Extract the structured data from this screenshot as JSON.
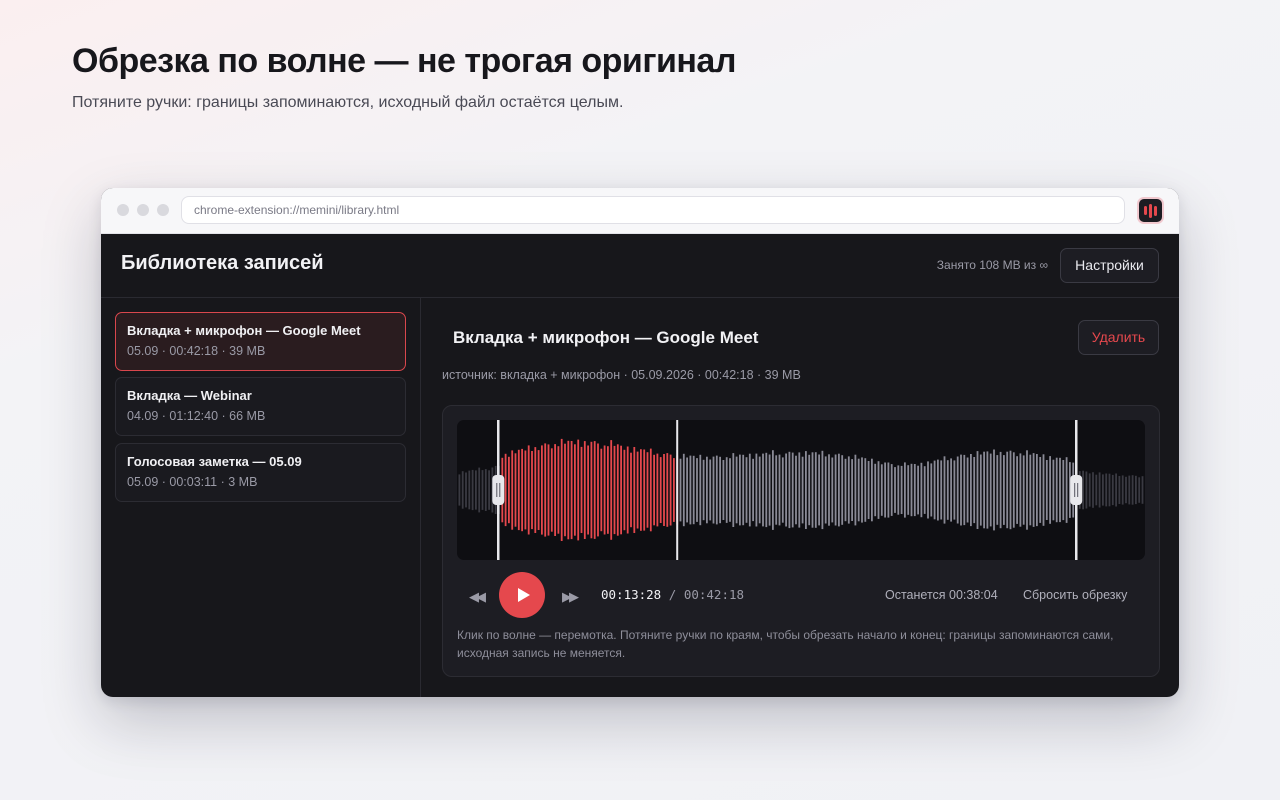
{
  "hero": {
    "title": "Обрезка по волне — не трогая оригинал",
    "subtitle": "Потяните ручки: границы запоминаются, исходный файл остаётся целым."
  },
  "browser": {
    "url": "chrome-extension://memini/library.html",
    "extension_icon": "waveform-bars-icon"
  },
  "header": {
    "title": "Библиотека записей",
    "storage": "Занято 108 MB из ∞",
    "settings_label": "Настройки"
  },
  "sidebar": {
    "items": [
      {
        "title": "Вкладка + микрофон — Google Meet",
        "meta": "05.09 · 00:42:18 · 39 MB",
        "active": true
      },
      {
        "title": "Вкладка — Webinar",
        "meta": "04.09 · 01:12:40 · 66 MB",
        "active": false
      },
      {
        "title": "Голосовая заметка — 05.09",
        "meta": "05.09 · 00:03:11 · 3 MB",
        "active": false
      }
    ]
  },
  "detail": {
    "title": "Вкладка + микрофон — Google Meet",
    "delete_label": "Удалить",
    "meta": "источник: вкладка + микрофон · 05.09.2026 · 00:42:18 · 39 MB"
  },
  "player": {
    "current_time": "00:13:28",
    "separator": "/",
    "total_time": "00:42:18",
    "remaining": "Останется 00:38:04",
    "reset_label": "Сбросить обрезку",
    "hint": "Клик по волне — перемотка. Потяните ручки по краям, чтобы обрезать начало и конец: границы запоминаются сами, исходная запись не меняется.",
    "trim_start_fraction": 0.06,
    "trim_end_fraction": 0.9,
    "playhead_fraction": 0.32,
    "colors": {
      "played": "#e5484d",
      "unplayed": "#8a8a96",
      "trimmed": "#3a3a42",
      "accent": "#e5484d"
    }
  }
}
